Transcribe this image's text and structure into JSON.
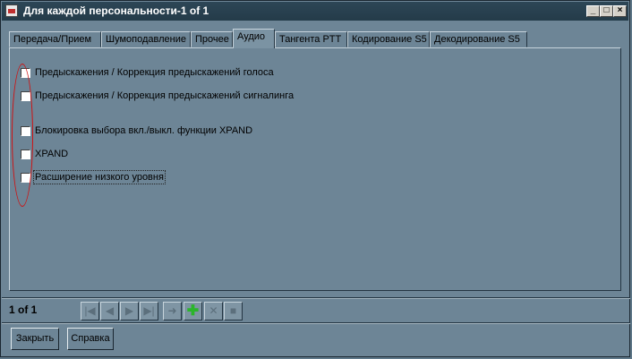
{
  "window": {
    "title": "Для каждой персональности-1 of 1"
  },
  "title_buttons": {
    "minimize": "_",
    "maximize": "□",
    "close": "×"
  },
  "tabs": [
    {
      "label": "Передача/Прием"
    },
    {
      "label": "Шумоподавление"
    },
    {
      "label": "Прочее"
    },
    {
      "label": "Аудио",
      "active": true
    },
    {
      "label": "Тангента PTT"
    },
    {
      "label": "Кодирование S5"
    },
    {
      "label": "Декодирование S5"
    }
  ],
  "options": [
    {
      "label": "Предыскажения / Коррекция предыскажений голоса",
      "checked": false
    },
    {
      "label": "Предыскажения / Коррекция предыскажений сигналинга",
      "checked": false
    },
    {
      "label": "Блокировка выбора вкл./выкл. функции XPAND",
      "checked": false
    },
    {
      "label": "XPAND",
      "checked": false
    },
    {
      "label": "Расширение низкого уровня",
      "checked": false
    }
  ],
  "record_counter": "1 of 1",
  "nav_icons": [
    "first-record-icon",
    "prev-record-icon",
    "next-record-icon",
    "last-record-icon",
    "goto-icon",
    "add-record-icon",
    "delete-record-icon",
    "stop-icon"
  ],
  "buttons": {
    "close": "Закрыть",
    "help": "Справка"
  }
}
